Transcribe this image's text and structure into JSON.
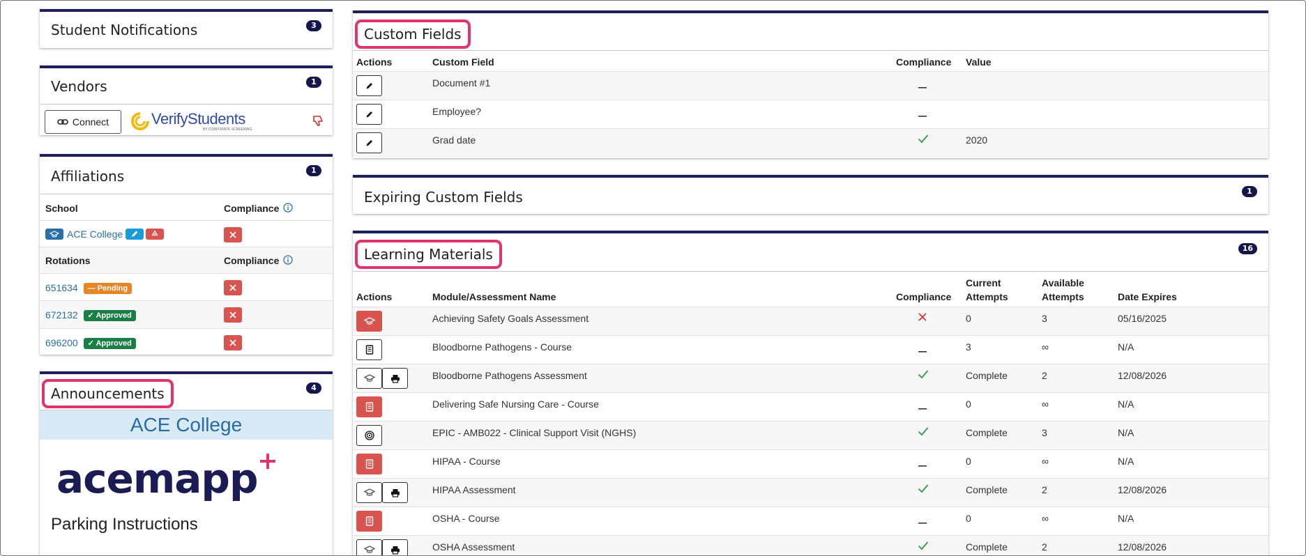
{
  "notifications": {
    "title": "Student Notifications",
    "count": "3"
  },
  "vendors": {
    "title": "Vendors",
    "count": "1",
    "connect_label": "Connect",
    "vendor_name": "VerifyStudents",
    "vendor_tagline": "BY CORPORATE SCREENING"
  },
  "affiliations": {
    "title": "Affiliations",
    "count": "1",
    "school_header": "School",
    "compliance_header": "Compliance",
    "school_name": "ACE College",
    "rotations_header": "Rotations",
    "rotations": [
      {
        "id": "651634",
        "status": "Pending"
      },
      {
        "id": "672132",
        "status": "Approved"
      },
      {
        "id": "696200",
        "status": "Approved"
      }
    ]
  },
  "announcements": {
    "title": "Announcements",
    "count": "4",
    "banner": "ACE College",
    "logo_text": "acemapp",
    "subheading": "Parking Instructions"
  },
  "custom_fields": {
    "title": "Custom Fields",
    "headers": {
      "actions": "Actions",
      "field": "Custom Field",
      "compliance": "Compliance",
      "value": "Value"
    },
    "rows": [
      {
        "field": "Document #1",
        "compliance": "dash",
        "value": ""
      },
      {
        "field": "Employee?",
        "compliance": "dash",
        "value": ""
      },
      {
        "field": "Grad date",
        "compliance": "check",
        "value": "2020"
      }
    ]
  },
  "expiring_custom_fields": {
    "title": "Expiring Custom Fields",
    "count": "1"
  },
  "learning_materials": {
    "title": "Learning Materials",
    "count": "16",
    "headers": {
      "actions": "Actions",
      "name": "Module/Assessment Name",
      "compliance": "Compliance",
      "current_1": "Current",
      "current_2": "Attempts",
      "available_1": "Available",
      "available_2": "Attempts",
      "expires": "Date Expires"
    },
    "rows": [
      {
        "name": "Achieving Safety Goals Assessment",
        "compliance": "x",
        "current": "0",
        "available": "3",
        "expires": "05/16/2025",
        "actions": [
          "cap-red"
        ]
      },
      {
        "name": "Bloodborne Pathogens - Course",
        "compliance": "dash",
        "current": "3",
        "available": "∞",
        "expires": "N/A",
        "actions": [
          "book"
        ]
      },
      {
        "name": "Bloodborne Pathogens Assessment",
        "compliance": "check",
        "current": "Complete",
        "available": "2",
        "expires": "12/08/2026",
        "actions": [
          "cap",
          "print"
        ]
      },
      {
        "name": "Delivering Safe Nursing Care - Course",
        "compliance": "dash",
        "current": "0",
        "available": "∞",
        "expires": "N/A",
        "actions": [
          "book-red"
        ]
      },
      {
        "name": "EPIC - AMB022 - Clinical Support Visit (NGHS)",
        "compliance": "check",
        "current": "Complete",
        "available": "3",
        "expires": "N/A",
        "actions": [
          "target"
        ]
      },
      {
        "name": "HIPAA - Course",
        "compliance": "dash",
        "current": "0",
        "available": "∞",
        "expires": "N/A",
        "actions": [
          "book-red"
        ]
      },
      {
        "name": "HIPAA Assessment",
        "compliance": "check",
        "current": "Complete",
        "available": "2",
        "expires": "12/08/2026",
        "actions": [
          "cap",
          "print"
        ]
      },
      {
        "name": "OSHA - Course",
        "compliance": "dash",
        "current": "0",
        "available": "∞",
        "expires": "N/A",
        "actions": [
          "book-red"
        ]
      },
      {
        "name": "OSHA Assessment",
        "compliance": "check",
        "current": "Complete",
        "available": "2",
        "expires": "12/08/2026",
        "actions": [
          "cap",
          "print"
        ]
      }
    ]
  },
  "colors": {
    "accent": "#1d1f5c",
    "highlight": "#e0346a",
    "danger": "#d9534f",
    "success": "#1a7f45",
    "pending": "#e88524",
    "link": "#2b6fa8"
  }
}
